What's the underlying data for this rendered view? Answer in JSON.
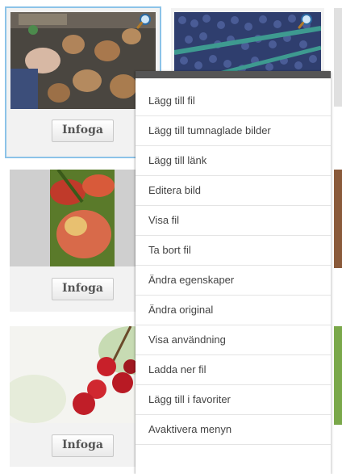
{
  "tiles": {
    "insert_label": "Infoga"
  },
  "menu": {
    "items": [
      "Lägg till fil",
      "Lägg till tumnaglade bilder",
      "Lägg till länk",
      "Editera bild",
      "Visa fil",
      "Ta bort fil",
      "Ändra egenskaper",
      "Ändra original",
      "Visa användning",
      "Ladda ner fil",
      "Lägg till i favoriter",
      "Avaktivera menyn"
    ]
  },
  "icons": {
    "zoom": "magnifier-icon"
  },
  "colors": {
    "selected_border": "#8cc3e8",
    "menu_header": "#555555"
  }
}
